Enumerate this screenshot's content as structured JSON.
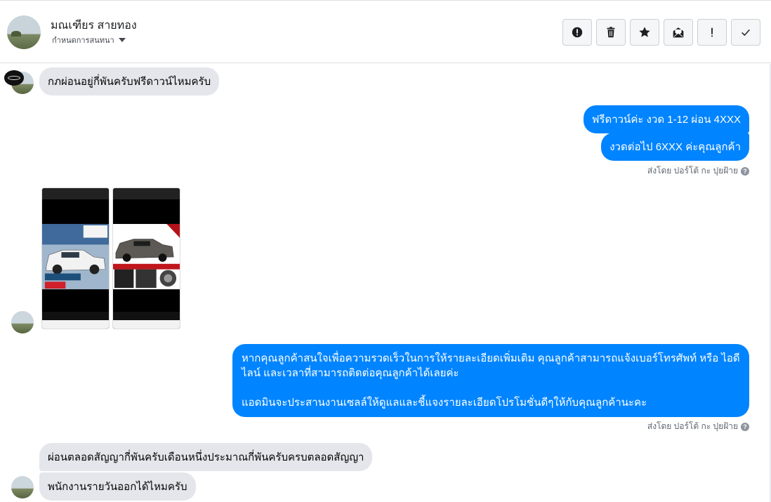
{
  "header": {
    "name": "มณเฑียร สายทอง",
    "assign_label": "กำหนดการสนทนา"
  },
  "toolbar": {
    "buttons": [
      {
        "name": "report",
        "icon": "exclamation-circle-icon"
      },
      {
        "name": "delete",
        "icon": "trash-icon"
      },
      {
        "name": "star",
        "icon": "star-icon"
      },
      {
        "name": "mark-unread",
        "icon": "envelope-icon"
      },
      {
        "name": "spam",
        "icon": "exclamation-icon"
      },
      {
        "name": "done",
        "icon": "check-icon"
      }
    ]
  },
  "messages": {
    "m1": "กภผ่อนอยู่กี่พันครับฟรีดาวน์ไหมครับ",
    "m2": "ฟรีดาวน์ค่ะ งวด 1-12 ผ่อน 4XXX",
    "m3": "งวดต่อไป 6XXX ค่ะคุณลูกค้า",
    "sent_by_1": "ส่งโดย ปอร์โต้ กะ ปุยฝ้าย",
    "m4_line1": "หากคุณลูกค้าสนใจเพื่อความรวดเร็วในการให้รายละเอียดเพิ่มเติม คุณลูกค้าสามารถแจ้งเบอร์โทรศัพท์ หรือ ไอดีไลน์ และเวลาที่สามารถติดต่อคุณลูกค้าได้เลยค่ะ",
    "m4_line2": "แอดมินจะประสานงานเซลล์ให้ดูแลและชี้แจงรายละเอียดโปรโมชั่นดีๆให้กับคุณลูกค้านะคะ",
    "sent_by_2": "ส่งโดย ปอร์โต้ กะ ปุยฝ้าย",
    "m5": "ผ่อนตลอดสัญญากี่พันครับเดือนหนึ่งประมาณกี่พันครับครบตลอดสัญญา",
    "m6": "พนักงานรายวันออกได้ไหมครับ"
  },
  "colors": {
    "outgoing": "#0084ff",
    "incoming": "#e4e6eb"
  }
}
